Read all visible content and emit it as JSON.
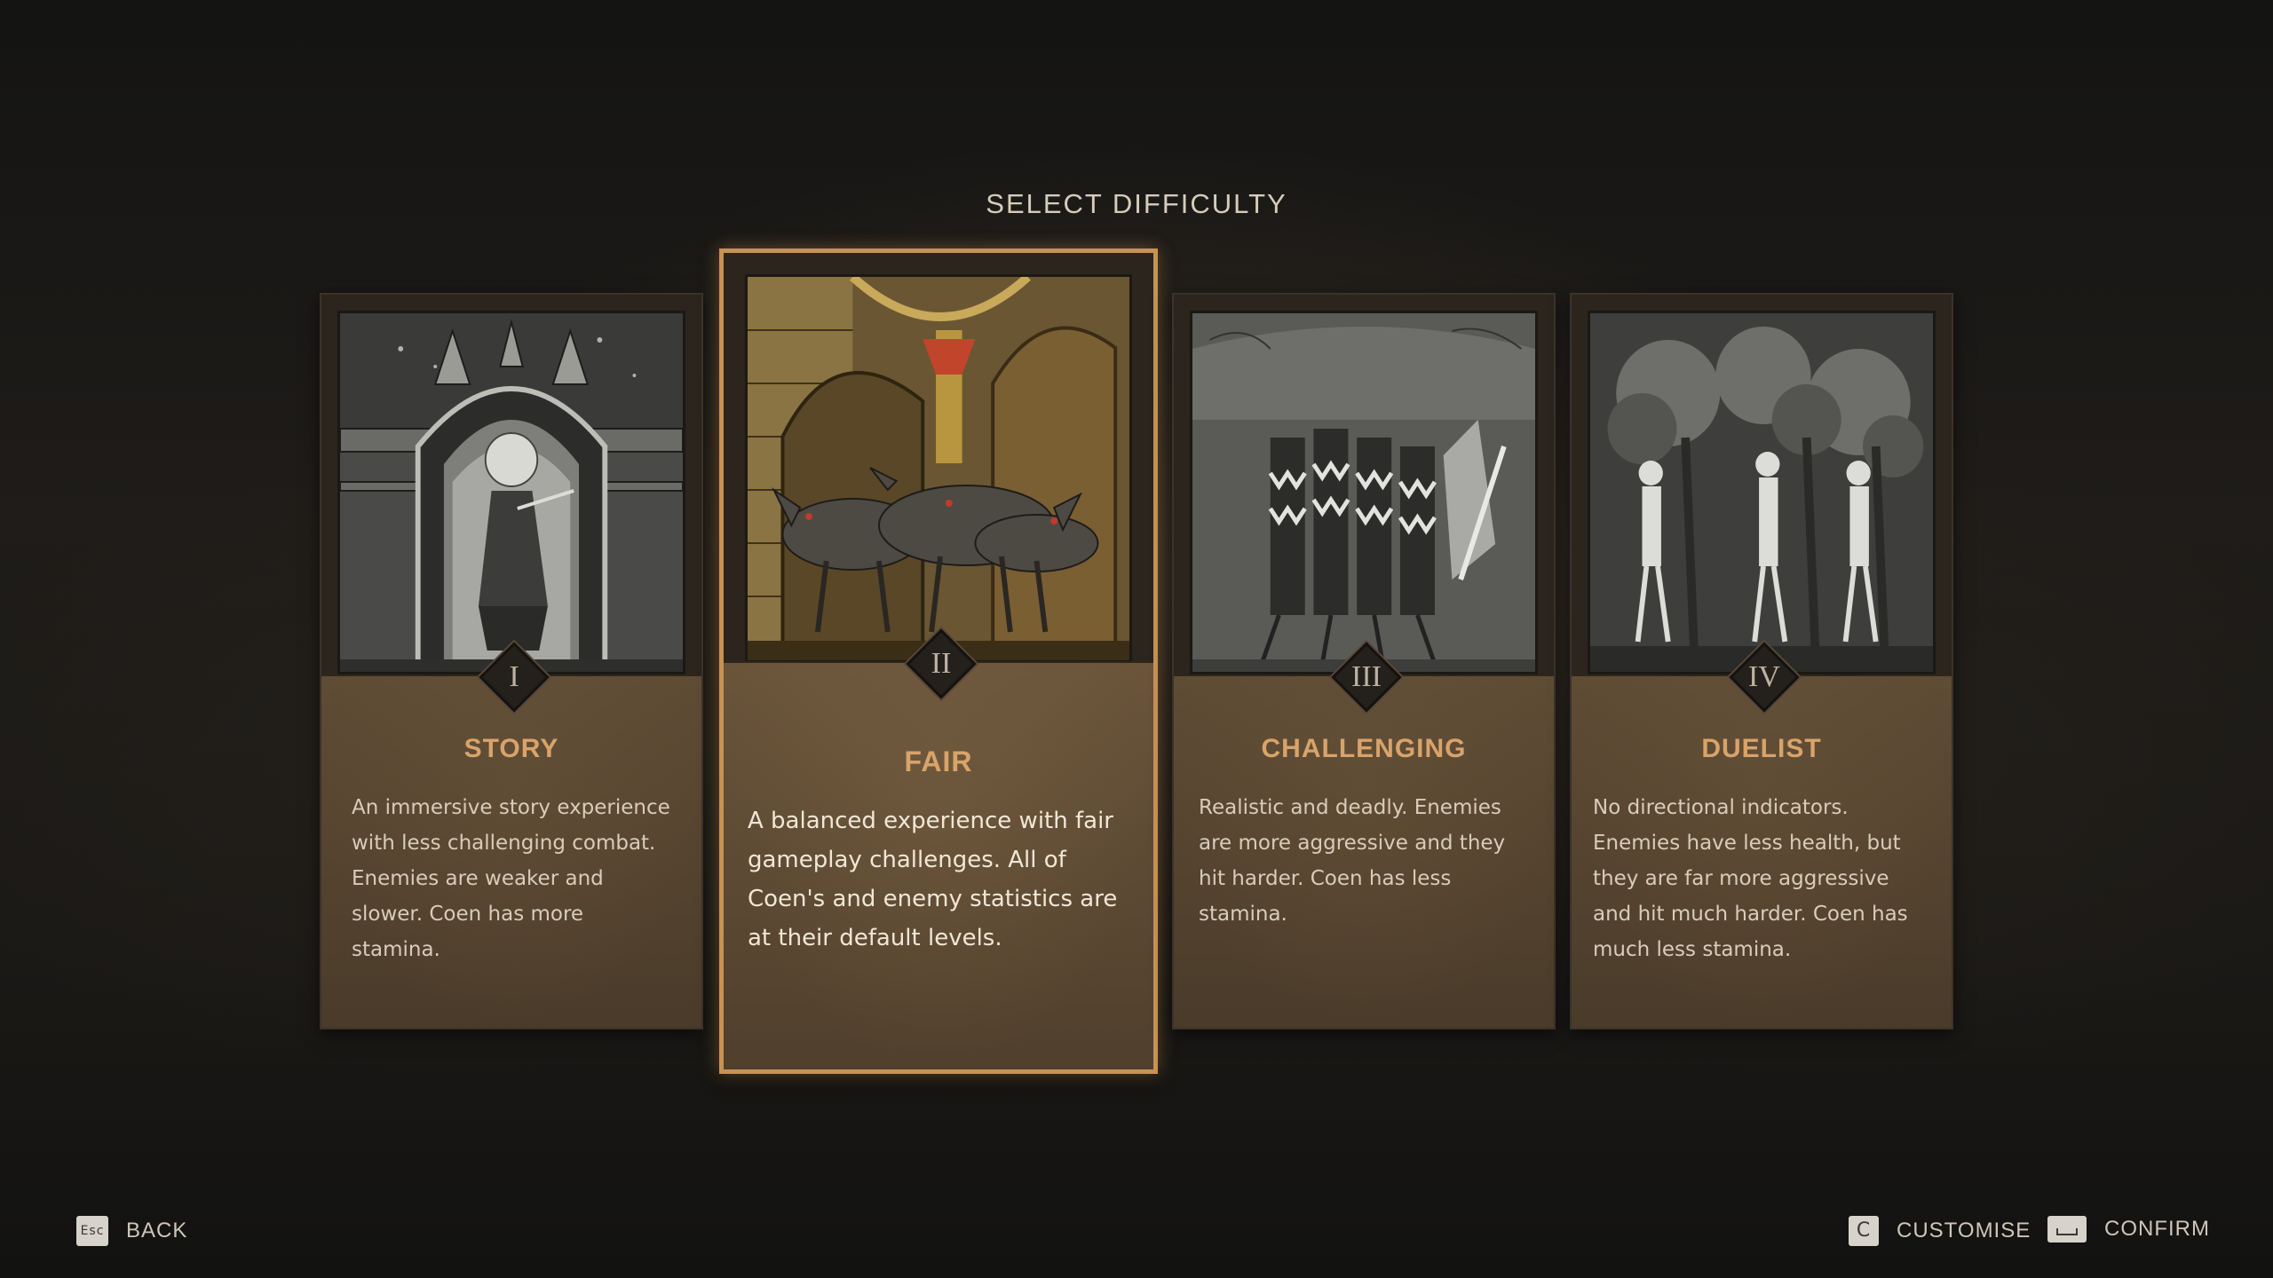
{
  "screen": {
    "title": "SELECT DIFFICULTY"
  },
  "difficulties": [
    {
      "numeral": "I",
      "name": "STORY",
      "description": "An immersive story experience with less challenging combat. Enemies are weaker and slower. Coen has more stamina.",
      "selected": false
    },
    {
      "numeral": "II",
      "name": "FAIR",
      "description": "A balanced experience with fair gameplay challenges. All of Coen's and enemy statistics are at their default levels.",
      "selected": true
    },
    {
      "numeral": "III",
      "name": "CHALLENGING",
      "description": "Realistic and deadly. Enemies are more aggressive and they hit harder. Coen has less stamina.",
      "selected": false
    },
    {
      "numeral": "IV",
      "name": "DUELIST",
      "description": "No directional indicators. Enemies have less health, but they are far more aggressive and hit much harder. Coen has much less stamina.",
      "selected": false
    }
  ],
  "footer": {
    "back": {
      "key": "Esc",
      "label": "BACK"
    },
    "customise": {
      "key": "C",
      "label": "CUSTOMISE"
    },
    "confirm": {
      "key": "space-key-icon",
      "label": "CONFIRM"
    }
  },
  "colors": {
    "accent_gold": "#c79252",
    "title_gold": "#d9a36a",
    "panel_brown": "#5f4c35"
  }
}
